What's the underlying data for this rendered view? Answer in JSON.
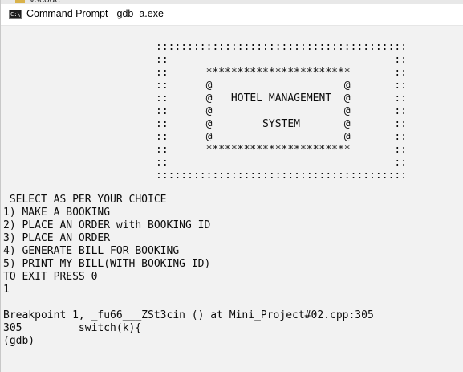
{
  "background_window": {
    "title": "vscode"
  },
  "window": {
    "title": "Command Prompt - gdb  a.exe",
    "icon": "cmd-icon",
    "icon_glyph": "C:\\"
  },
  "console": {
    "banner": [
      "::::::::::::::::::::::::::::::::::::::::",
      "::                                    ::",
      "::      ***********************       ::",
      "::      @                     @       ::",
      "::      @   HOTEL MANAGEMENT  @       ::",
      "::      @                     @       ::",
      "::      @        SYSTEM       @       ::",
      "::      @                     @       ::",
      "::      ***********************       ::",
      "::                                    ::",
      "::::::::::::::::::::::::::::::::::::::::"
    ],
    "menu": [
      " SELECT AS PER YOUR CHOICE",
      "1) MAKE A BOOKING",
      "2) PLACE AN ORDER with BOOKING ID",
      "3) PLACE AN ORDER",
      "4) GENERATE BILL FOR BOOKING",
      "5) PRINT MY BILL(WITH BOOKING ID)",
      "TO EXIT PRESS 0",
      "1"
    ],
    "gdb": [
      "Breakpoint 1, _fu66___ZSt3cin () at Mini_Project#02.cpp:305",
      "305         switch(k){",
      "(gdb)"
    ]
  }
}
